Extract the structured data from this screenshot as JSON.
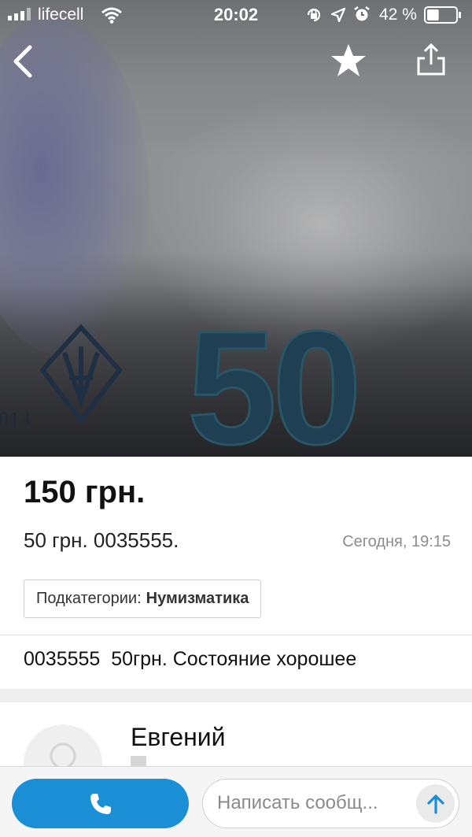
{
  "status_bar": {
    "carrier": "lifecell",
    "time": "20:02",
    "battery_percent": "42 %",
    "battery_level": 0.42,
    "icons": [
      "signal-icon",
      "wifi-icon",
      "orientation-lock-icon",
      "location-icon",
      "alarm-icon",
      "battery-icon"
    ]
  },
  "nav": {
    "icons": [
      "back-arrow-icon",
      "star-icon",
      "share-icon"
    ]
  },
  "hero": {
    "banknote_figure": "50",
    "year_mark": "014"
  },
  "listing": {
    "price": "150 грн.",
    "title": "50 грн. 0035555.",
    "date": "Сегодня, 19:15",
    "category_label": "Подкатегории:",
    "category_value": "Нумизматика",
    "description": "0035555  50грн. Состояние хорошее"
  },
  "seller": {
    "name": "Евгений"
  },
  "actions": {
    "message_placeholder": "Написать сообщ...",
    "icons": [
      "phone-icon",
      "arrow-up-icon"
    ]
  },
  "colors": {
    "accent": "#1a8fd6",
    "price_text": "#111111",
    "meta_text": "#8c8c8c",
    "separator": "#eeeeee"
  }
}
